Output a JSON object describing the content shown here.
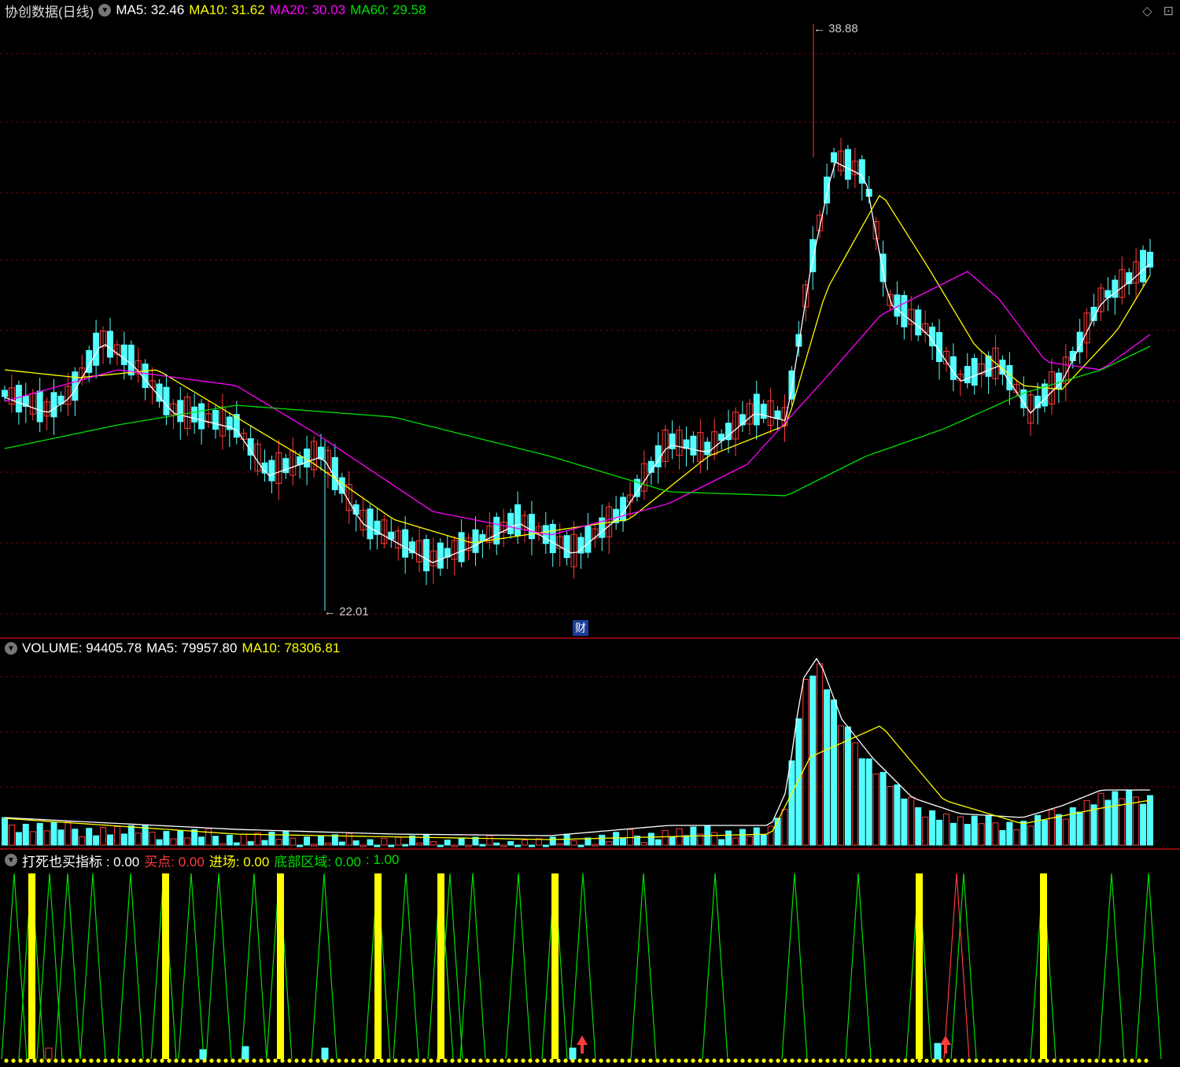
{
  "main": {
    "title": "协创数据(日线)",
    "ma5": "MA5: 32.46",
    "ma10": "MA10: 31.62",
    "ma20": "MA20: 30.03",
    "ma60": "MA60: 29.58",
    "high_label": "38.88",
    "low_label": "22.01",
    "fin_badge": "财"
  },
  "volume": {
    "label": "VOLUME: 94405.78",
    "ma5": "MA5: 79957.80",
    "ma10": "MA10: 78306.81"
  },
  "indicator": {
    "name": "打死也买指标 : 0.00",
    "buy": "买点: 0.00",
    "entry": "进场: 0.00",
    "bottom": "底部区域: 0.00",
    "extra": ": 1.00"
  },
  "colors": {
    "bg": "#000000",
    "up": "#ff3b3b",
    "down": "#54ffff",
    "ma5": "#ffffff",
    "ma10": "#ffff00",
    "ma20": "#ff00ff",
    "ma60": "#00e000",
    "grid": "#7a0000"
  },
  "icons": {
    "collapse": "chevron-down-icon",
    "diamond": "diamond-icon",
    "maximize": "maximize-icon"
  }
}
